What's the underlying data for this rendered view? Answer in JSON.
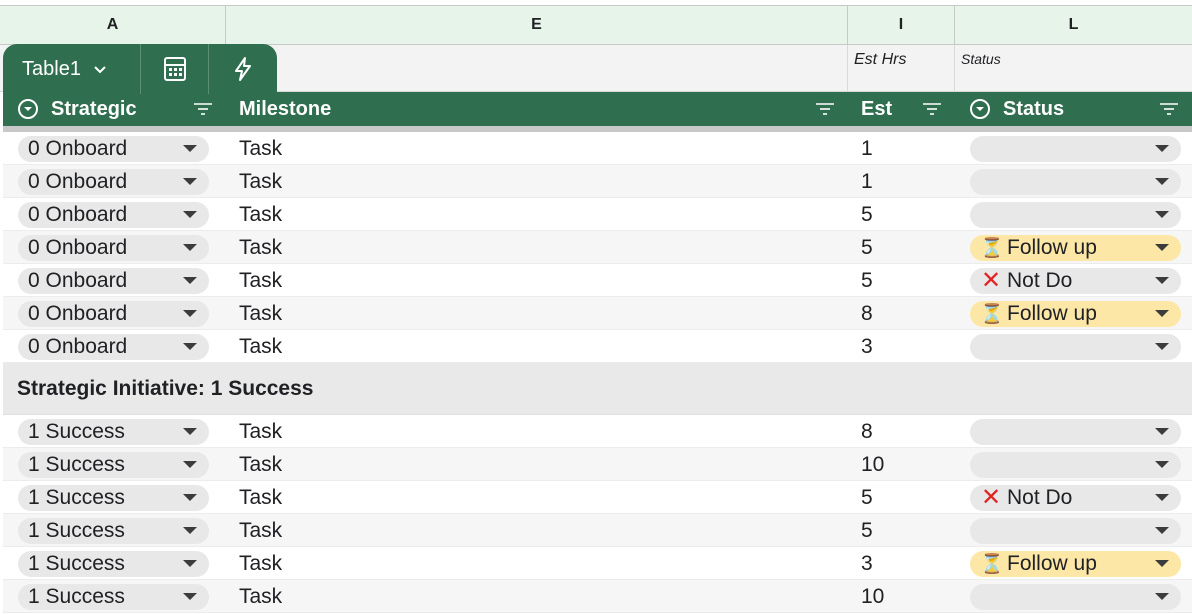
{
  "columns": {
    "a": "A",
    "e": "E",
    "i": "I",
    "l": "L"
  },
  "row1": {
    "est_label": "Est Hrs",
    "status_label": "Status"
  },
  "table": {
    "name": "Table1"
  },
  "headers": {
    "strategic": "Strategic",
    "milestone": "Milestone",
    "est": "Est",
    "status": "Status"
  },
  "rows_group0": [
    {
      "strategic": "0 Onboard",
      "milestone": "Task",
      "est": "1",
      "status": ""
    },
    {
      "strategic": "0 Onboard",
      "milestone": "Task",
      "est": "1",
      "status": ""
    },
    {
      "strategic": "0 Onboard",
      "milestone": "Task",
      "est": "5",
      "status": ""
    },
    {
      "strategic": "0 Onboard",
      "milestone": "Task",
      "est": "5",
      "status": "Follow up"
    },
    {
      "strategic": "0 Onboard",
      "milestone": "Task",
      "est": "5",
      "status": "Not Do"
    },
    {
      "strategic": "0 Onboard",
      "milestone": "Task",
      "est": "8",
      "status": "Follow up"
    },
    {
      "strategic": "0 Onboard",
      "milestone": "Task",
      "est": "3",
      "status": ""
    }
  ],
  "group1": {
    "title": "Strategic Initiative: 1 Success"
  },
  "rows_group1": [
    {
      "strategic": "1 Success",
      "milestone": "Task",
      "est": "8",
      "status": ""
    },
    {
      "strategic": "1 Success",
      "milestone": "Task",
      "est": "10",
      "status": ""
    },
    {
      "strategic": "1 Success",
      "milestone": "Task",
      "est": "5",
      "status": "Not Do"
    },
    {
      "strategic": "1 Success",
      "milestone": "Task",
      "est": "5",
      "status": ""
    },
    {
      "strategic": "1 Success",
      "milestone": "Task",
      "est": "3",
      "status": "Follow up"
    },
    {
      "strategic": "1 Success",
      "milestone": "Task",
      "est": "10",
      "status": ""
    }
  ],
  "icons": {
    "follow_up": "hourglass-icon",
    "not_do": "red-x-icon"
  },
  "colors": {
    "accent": "#2f6f4f",
    "follow_up_bg": "#fde7a6",
    "not_do": "#e02424"
  }
}
